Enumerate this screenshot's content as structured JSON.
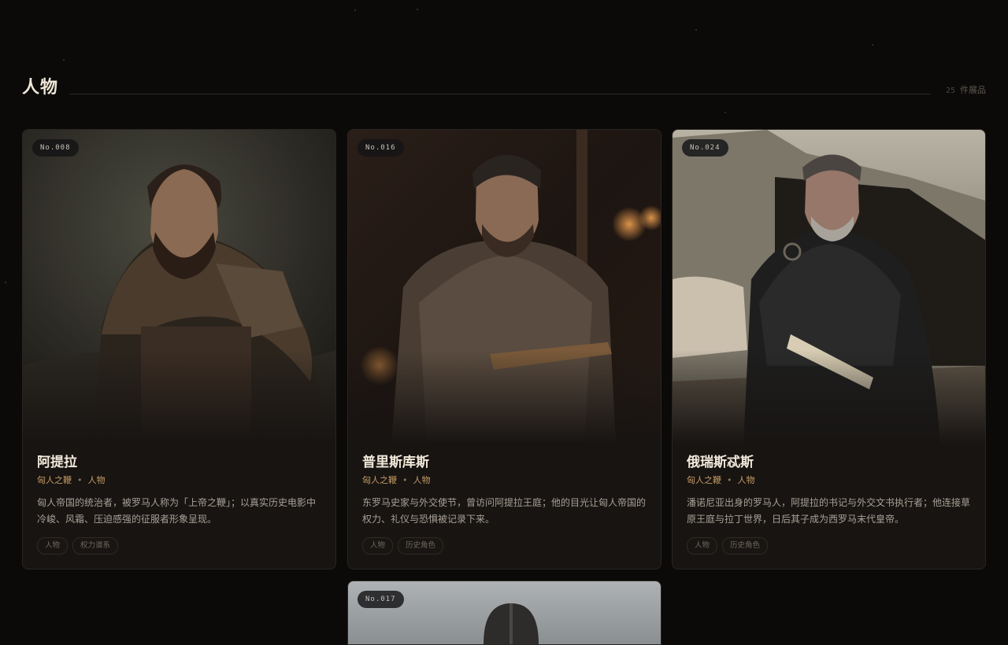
{
  "section": {
    "title": "人物",
    "count_number": "25",
    "count_label": "件展品"
  },
  "cards": [
    {
      "number": "No.008",
      "name": "阿提拉",
      "category": "匈人之鞭",
      "type": "人物",
      "description": "匈人帝国的统治者，被罗马人称为「上帝之鞭」；以真实历史电影中冷峻、风霜、压迫感强的征服者形象呈现。",
      "tags": [
        "人物",
        "权力谱系"
      ],
      "image_alt": "braided-warrior-in-fur-and-armor"
    },
    {
      "number": "No.016",
      "name": "普里斯库斯",
      "category": "匈人之鞭",
      "type": "人物",
      "description": "东罗马史家与外交使节，曾访问阿提拉王庭；他的目光让匈人帝国的权力、礼仪与恐惧被记录下来。",
      "tags": [
        "人物",
        "历史角色"
      ],
      "image_alt": "scribe-with-quill-and-tablet"
    },
    {
      "number": "No.024",
      "name": "俄瑞斯忒斯",
      "category": "匈人之鞭",
      "type": "人物",
      "description": "潘诺尼亚出身的罗马人，阿提拉的书记与外交文书执行者；他连接草原王庭与拉丁世界，日后其子成为西罗马末代皇帝。",
      "tags": [
        "人物",
        "历史角色"
      ],
      "image_alt": "grey-bearded-man-with-scroll-before-tents"
    },
    {
      "number": "No.017",
      "image_alt": "warrior-in-round-helmet"
    }
  ],
  "colors": {
    "background": "#0b0a09",
    "card": "#171412",
    "accent": "#c59a63"
  }
}
